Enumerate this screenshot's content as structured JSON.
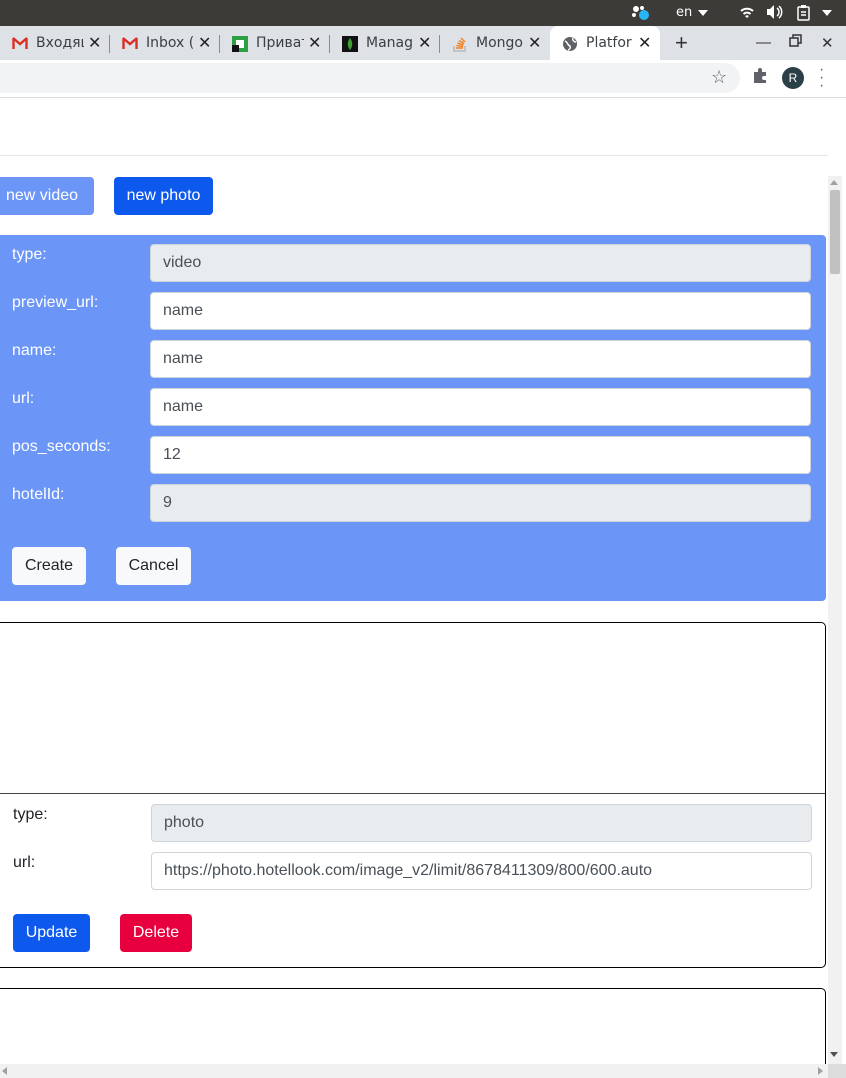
{
  "os_bar": {
    "language": "en"
  },
  "tabs": [
    {
      "title": "Входящ",
      "icon": "gmail-icon"
    },
    {
      "title": "Inbox (",
      "icon": "gmail-icon"
    },
    {
      "title": "Приват",
      "icon": "green-site-icon"
    },
    {
      "title": "Manag",
      "icon": "mongodb-leaf-icon"
    },
    {
      "title": "Mongo",
      "icon": "stackoverflow-icon"
    },
    {
      "title": "Platfor",
      "icon": "globe-icon",
      "active": true
    }
  ],
  "profile_initial": "R",
  "actions": {
    "new_video": "new video",
    "new_photo": "new photo"
  },
  "create_form": {
    "fields": [
      {
        "label": "type:",
        "value": "video",
        "readonly": true
      },
      {
        "label": "preview_url:",
        "value": "name"
      },
      {
        "label": "name:",
        "value": "name"
      },
      {
        "label": "url:",
        "value": "name"
      },
      {
        "label": "pos_seconds:",
        "value": "12"
      },
      {
        "label": "hotelId:",
        "value": "9",
        "readonly": true
      }
    ],
    "create_label": "Create",
    "cancel_label": "Cancel"
  },
  "photo_card": {
    "fields": [
      {
        "label": "type:",
        "value": "photo",
        "readonly": true
      },
      {
        "label": "url:",
        "value": "https://photo.hotellook.com/image_v2/limit/8678411309/800/600.auto"
      }
    ],
    "update_label": "Update",
    "delete_label": "Delete"
  },
  "colors": {
    "primary": "#0d59ee",
    "primary_light": "#6b96f7",
    "danger": "#e8003e",
    "input_readonly": "#e9ecef"
  }
}
